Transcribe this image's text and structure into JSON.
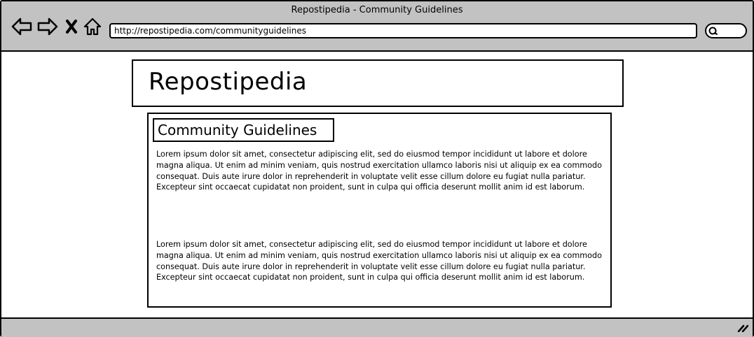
{
  "window": {
    "title": "Repostipedia - Community Guidelines",
    "url": "http://repostipedia.com/communityguidelines"
  },
  "icons": [
    "back-arrow-icon",
    "forward-arrow-icon",
    "stop-x-icon",
    "home-icon",
    "search-icon",
    "resize-grip-icon"
  ],
  "site": {
    "name": "Repostipedia"
  },
  "article": {
    "heading": "Community Guidelines",
    "paragraphs": [
      "Lorem ipsum dolor sit amet, consectetur adipiscing elit, sed do eiusmod tempor incididunt ut labore et dolore magna aliqua. Ut enim ad minim veniam, quis nostrud exercitation ullamco laboris nisi ut aliquip ex ea commodo consequat. Duis aute irure dolor in reprehenderit in voluptate velit esse cillum dolore eu fugiat nulla pariatur. Excepteur sint occaecat cupidatat non proident, sunt in culpa qui officia deserunt mollit anim id est laborum.",
      "Lorem ipsum dolor sit amet, consectetur adipiscing elit, sed do eiusmod tempor incididunt ut labore et dolore magna aliqua. Ut enim ad minim veniam, quis nostrud exercitation ullamco laboris nisi ut aliquip ex ea commodo consequat. Duis aute irure dolor in reprehenderit in voluptate velit esse cillum dolore eu fugiat nulla pariatur. Excepteur sint occaecat cupidatat non proident, sunt in culpa qui officia deserunt mollit anim id est laborum."
    ]
  },
  "colors": {
    "chrome": "#c2c2c2",
    "background": "#ffffff",
    "ink": "#000000"
  }
}
